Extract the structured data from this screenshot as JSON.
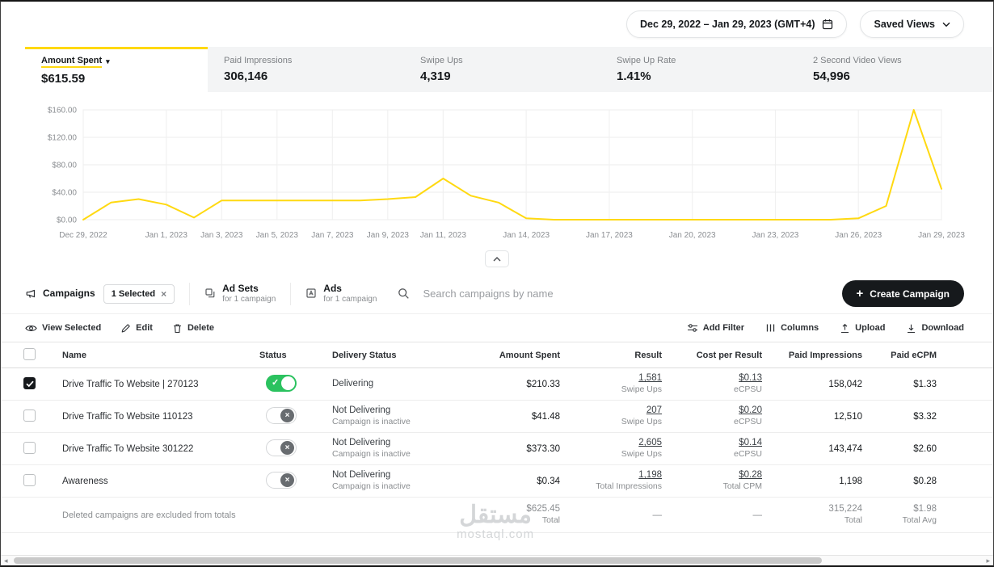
{
  "header": {
    "date_range": "Dec 29, 2022 – Jan 29, 2023 (GMT+4)",
    "saved_views": "Saved Views"
  },
  "metrics": [
    {
      "label": "Amount Spent",
      "value": "$615.59",
      "selected": true
    },
    {
      "label": "Paid Impressions",
      "value": "306,146",
      "selected": false
    },
    {
      "label": "Swipe Ups",
      "value": "4,319",
      "selected": false
    },
    {
      "label": "Swipe Up Rate",
      "value": "1.41%",
      "selected": false
    },
    {
      "label": "2 Second Video Views",
      "value": "54,996",
      "selected": false
    }
  ],
  "chart_data": {
    "type": "line",
    "title": "Amount Spent by day",
    "x": [
      "Dec 29",
      "Dec 30",
      "Dec 31",
      "Jan 1",
      "Jan 2",
      "Jan 3",
      "Jan 4",
      "Jan 5",
      "Jan 6",
      "Jan 7",
      "Jan 8",
      "Jan 9",
      "Jan 10",
      "Jan 11",
      "Jan 12",
      "Jan 13",
      "Jan 14",
      "Jan 15",
      "Jan 16",
      "Jan 17",
      "Jan 18",
      "Jan 19",
      "Jan 20",
      "Jan 21",
      "Jan 22",
      "Jan 23",
      "Jan 24",
      "Jan 25",
      "Jan 26",
      "Jan 27",
      "Jan 28",
      "Jan 29"
    ],
    "series": [
      {
        "name": "Amount Spent",
        "values": [
          0,
          25,
          30,
          22,
          3,
          28,
          28,
          28,
          28,
          28,
          28,
          30,
          33,
          60,
          35,
          25,
          2,
          0,
          0,
          0,
          0,
          0,
          0,
          0,
          0,
          0,
          0,
          0,
          2,
          20,
          160,
          45
        ]
      }
    ],
    "ylim": [
      0,
      160
    ],
    "y_ticks": [
      "$0.00",
      "$40.00",
      "$80.00",
      "$120.00",
      "$160.00"
    ],
    "x_tick_days": [
      0,
      3,
      5,
      7,
      9,
      11,
      13,
      16,
      19,
      22,
      25,
      28,
      31
    ],
    "x_tick_labels": [
      "Dec 29, 2022",
      "Jan 1, 2023",
      "Jan 3, 2023",
      "Jan 5, 2023",
      "Jan 7, 2023",
      "Jan 9, 2023",
      "Jan 11, 2023",
      "Jan 14, 2023",
      "Jan 17, 2023",
      "Jan 20, 2023",
      "Jan 23, 2023",
      "Jan 26, 2023",
      "Jan 29, 2023"
    ],
    "line_color": "#ffd911",
    "grid": true,
    "legend": false
  },
  "tabs": {
    "campaigns": {
      "label": "Campaigns",
      "selected_chip": "1 Selected"
    },
    "ad_sets": {
      "label": "Ad Sets",
      "sub": "for 1 campaign"
    },
    "ads": {
      "label": "Ads",
      "sub": "for 1 campaign"
    },
    "search_placeholder": "Search campaigns by name",
    "create_button": "Create Campaign"
  },
  "toolbar": {
    "view_selected": "View Selected",
    "edit": "Edit",
    "delete": "Delete",
    "add_filter": "Add Filter",
    "columns": "Columns",
    "upload": "Upload",
    "download": "Download"
  },
  "table": {
    "columns": [
      "Name",
      "Status",
      "Delivery Status",
      "Amount Spent",
      "Result",
      "Cost per Result",
      "Paid Impressions",
      "Paid eCPM"
    ],
    "rows": [
      {
        "name": "Drive Traffic To Website | 270123",
        "checked": true,
        "status": "on",
        "delivery": "Delivering",
        "delivery_sub": "",
        "amount_spent": "$210.33",
        "result": "1,581",
        "result_sub": "Swipe Ups",
        "cost": "$0.13",
        "cost_sub": "eCPSU",
        "impressions": "158,042",
        "ecpm": "$1.33"
      },
      {
        "name": "Drive Traffic To Website 110123",
        "checked": false,
        "status": "off",
        "delivery": "Not Delivering",
        "delivery_sub": "Campaign is inactive",
        "amount_spent": "$41.48",
        "result": "207",
        "result_sub": "Swipe Ups",
        "cost": "$0.20",
        "cost_sub": "eCPSU",
        "impressions": "12,510",
        "ecpm": "$3.32"
      },
      {
        "name": "Drive Traffic To Website 301222",
        "checked": false,
        "status": "off",
        "delivery": "Not Delivering",
        "delivery_sub": "Campaign is inactive",
        "amount_spent": "$373.30",
        "result": "2,605",
        "result_sub": "Swipe Ups",
        "cost": "$0.14",
        "cost_sub": "eCPSU",
        "impressions": "143,474",
        "ecpm": "$2.60"
      },
      {
        "name": "Awareness",
        "checked": false,
        "status": "off",
        "delivery": "Not Delivering",
        "delivery_sub": "Campaign is inactive",
        "amount_spent": "$0.34",
        "result": "1,198",
        "result_sub": "Total Impressions",
        "cost": "$0.28",
        "cost_sub": "Total CPM",
        "impressions": "1,198",
        "ecpm": "$0.28"
      }
    ],
    "footer": {
      "note": "Deleted campaigns are excluded from totals",
      "amount_spent": "$625.45",
      "amount_spent_sub": "Total",
      "result": "—",
      "cost": "—",
      "impressions": "315,224",
      "impressions_sub": "Total",
      "ecpm": "$1.98",
      "ecpm_sub": "Total Avg"
    }
  },
  "icons": {
    "close": "×",
    "plus": "+",
    "caret_down": "▾",
    "check": "✓",
    "x_mark": "×",
    "scroll_left": "◂",
    "scroll_right": "▸"
  },
  "colors": {
    "accent_yellow": "#ffd911",
    "toggle_on_green": "#2bc25f",
    "button_black": "#16191c"
  },
  "watermark": {
    "arabic": "مستقل",
    "domain": "mostaql.com"
  }
}
